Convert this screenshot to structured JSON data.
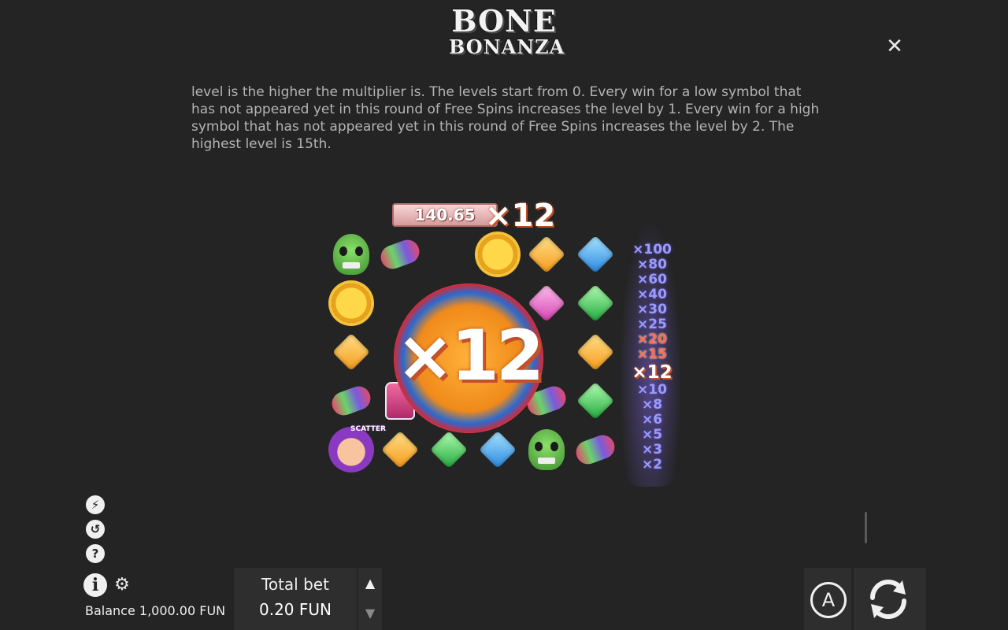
{
  "logo": {
    "line1": "BONE",
    "line2": "BONANZA"
  },
  "close_icon": "close-icon",
  "rules_text": "level is the higher the multiplier is. The levels start from 0. Every win for a low symbol that has not appeared yet in this round of Free Spins increases the level by 1. Every win for a high symbol that has not appeared yet in this round of Free Spins increases the level by 2. The highest level is 15th.",
  "illustration": {
    "win_amount": "140.65",
    "win_multiplier": "×12",
    "big_multiplier": "×12",
    "scatter_label": "SCATTER",
    "ladder": [
      "×100",
      "×80",
      "×60",
      "×40",
      "×30",
      "×25",
      "×20",
      "×15",
      "×12",
      "×10",
      "×8",
      "×6",
      "×5",
      "×3",
      "×2"
    ],
    "ladder_reached": [
      "×20",
      "×15"
    ],
    "ladder_current": "×12"
  },
  "side_icons": [
    "turbo-icon",
    "history-icon",
    "help-icon"
  ],
  "help_glyph": "?",
  "info_glyph": "i",
  "balance": {
    "label": "Balance",
    "value": "1,000.00 FUN"
  },
  "balance_text": "Balance 1,000.00 FUN",
  "bet": {
    "label": "Total bet",
    "value": "0.20 FUN"
  },
  "autoplay": {
    "glyph": "A"
  },
  "colors": {
    "background": "#242424",
    "panel": "#2e2e2e",
    "text": "#f0f0f0",
    "ladder": "#9a9cf5",
    "accent": "#ff6a4a"
  }
}
